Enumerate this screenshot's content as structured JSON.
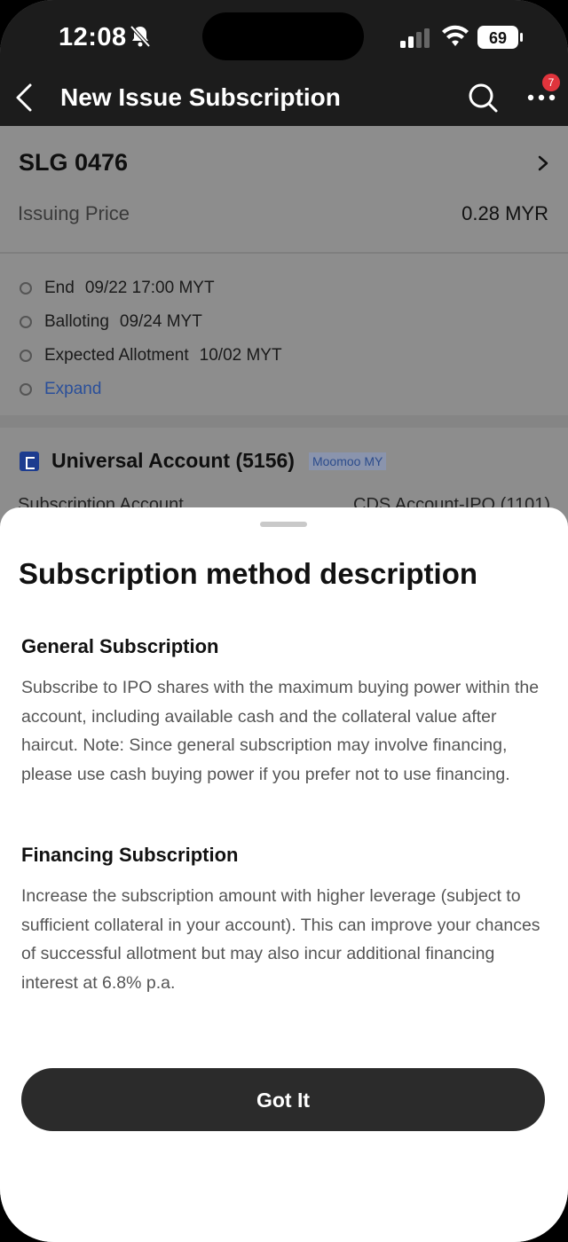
{
  "status_bar": {
    "time": "12:08",
    "battery": "69",
    "icons": [
      "bell-slash-icon",
      "cellular-signal-icon",
      "wifi-icon",
      "battery-icon"
    ]
  },
  "nav": {
    "title": "New Issue Subscription",
    "badge_count": "7",
    "icons": [
      "back-chevron-icon",
      "search-icon",
      "more-dots-icon"
    ]
  },
  "stock": {
    "code": "SLG 0476",
    "price_label": "Issuing Price",
    "price_value": "0.28 MYR"
  },
  "timeline": [
    {
      "label": "End",
      "value": "09/22 17:00 MYT"
    },
    {
      "label": "Balloting",
      "value": "09/24 MYT"
    },
    {
      "label": "Expected Allotment",
      "value": "10/02 MYT"
    }
  ],
  "timeline_expand": "Expand",
  "account": {
    "name": "Universal Account (5156)",
    "tag": "Moomoo MY",
    "partial_left": "Subscription Account",
    "partial_right": "CDS Account-IPO (1101)"
  },
  "sheet": {
    "title": "Subscription method description",
    "sections": [
      {
        "title": "General Subscription",
        "body": "Subscribe to IPO shares with the maximum buying power within the account, including available cash and the collateral value after haircut. Note: Since general subscription may involve financing, please use cash buying power if you prefer not to use financing."
      },
      {
        "title": "Financing Subscription",
        "body": "Increase the subscription amount with higher leverage (subject to sufficient collateral in your account). This can improve your chances of successful allotment but may also incur additional financing interest at 6.8% p.a."
      }
    ],
    "button_label": "Got It"
  },
  "colors": {
    "nav_bg": "#1c1c1c",
    "overlay_bg": "#8d8d8d",
    "button_bg": "#2b2b2b",
    "badge": "#e0343c",
    "link": "#2a4f9a"
  }
}
